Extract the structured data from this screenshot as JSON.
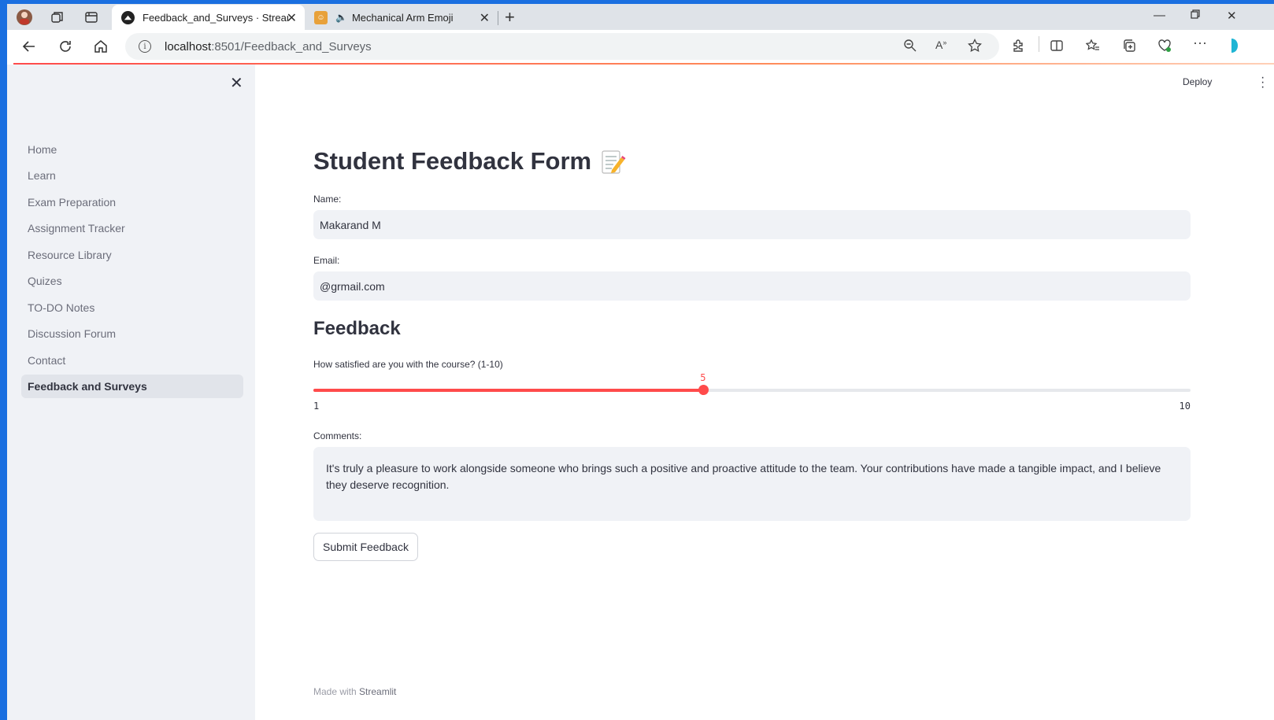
{
  "browser": {
    "tabs": [
      {
        "title": "Feedback_and_Surveys · Streamlit",
        "active": true
      },
      {
        "title": "Mechanical Arm Emoji",
        "active": false
      }
    ],
    "url_host": "localhost",
    "url_path": ":8501/Feedback_and_Surveys"
  },
  "header": {
    "deploy_label": "Deploy"
  },
  "sidebar": {
    "items": [
      {
        "label": "Home"
      },
      {
        "label": "Learn"
      },
      {
        "label": "Exam Preparation"
      },
      {
        "label": "Assignment Tracker"
      },
      {
        "label": "Resource Library"
      },
      {
        "label": "Quizes"
      },
      {
        "label": "TO-DO Notes"
      },
      {
        "label": "Discussion Forum"
      },
      {
        "label": "Contact"
      },
      {
        "label": "Feedback and Surveys",
        "selected": true
      }
    ]
  },
  "form": {
    "title": "Student Feedback Form",
    "name_label": "Name:",
    "name_value": "Makarand M",
    "email_label": "Email:",
    "email_value": "@grmail.com",
    "feedback_heading": "Feedback",
    "slider_label": "How satisfied are you with the course? (1-10)",
    "slider_value": "5",
    "slider_min": "1",
    "slider_max": "10",
    "comments_label": "Comments:",
    "comments_value": "It's truly a pleasure to work alongside someone who brings such a positive and proactive attitude to the team. Your contributions have made a tangible impact, and I believe they deserve recognition.",
    "submit_label": "Submit Feedback"
  },
  "footer": {
    "made_with": "Made with",
    "brand": "Streamlit"
  },
  "colors": {
    "accent": "#ff4b4b",
    "sidebar_bg": "#f0f2f6",
    "text": "#31333f"
  }
}
